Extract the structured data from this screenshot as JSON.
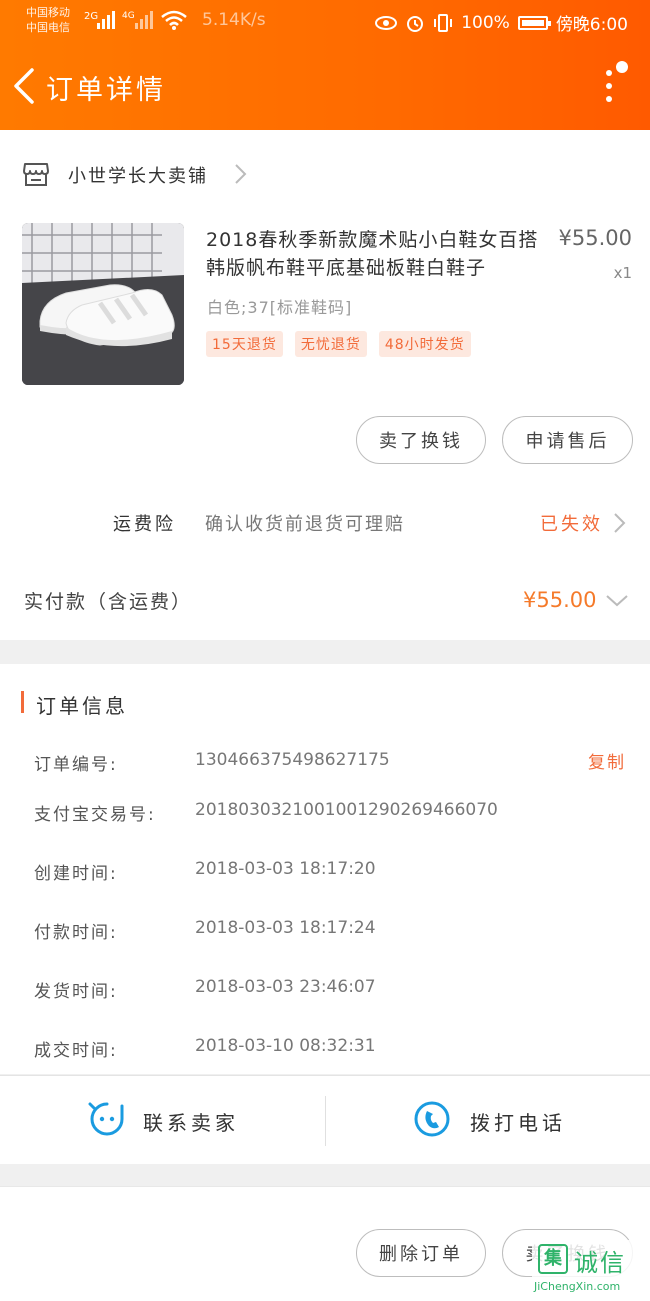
{
  "status_bar": {
    "carrier_1": "中国移动",
    "carrier_2": "中国电信",
    "net_1": "2G",
    "net_2": "4G",
    "speed": "5.14K/s",
    "battery": "100%",
    "time": "傍晚6:00"
  },
  "nav": {
    "title": "订单详情"
  },
  "shop": {
    "name": "小世学长大卖铺"
  },
  "product": {
    "title": "2018春秋季新款魔术贴小白鞋女百搭韩版帆布鞋平底基础板鞋白鞋子",
    "price": "¥55.00",
    "quantity": "x1",
    "spec": "白色;37[标准鞋码]",
    "tags": [
      "15天退货",
      "无忧退货",
      "48小时发货"
    ]
  },
  "item_actions": {
    "sell_label": "卖了换钱",
    "after_sale_label": "申请售后"
  },
  "insurance": {
    "label": "运费险",
    "desc": "确认收货前退货可理赔",
    "status": "已失效"
  },
  "payment": {
    "label": "实付款（含运费）",
    "value": "¥55.00"
  },
  "order_info": {
    "title": "订单信息",
    "copy_label": "复制",
    "rows": [
      {
        "label": "订单编号:",
        "value": "130466375498627175"
      },
      {
        "label": "支付宝交易号:",
        "value": "2018030321001001290269466070"
      },
      {
        "label": "创建时间:",
        "value": "2018-03-03 18:17:20"
      },
      {
        "label": "付款时间:",
        "value": "2018-03-03 18:17:24"
      },
      {
        "label": "发货时间:",
        "value": "2018-03-03 23:46:07"
      },
      {
        "label": "成交时间:",
        "value": "2018-03-10 08:32:31"
      }
    ]
  },
  "contact": {
    "seller_label": "联系卖家",
    "call_label": "拨打电话"
  },
  "bottom": {
    "delete_label": "删除订单",
    "sell_label": "卖了换钱"
  },
  "watermark": {
    "logo_char": "集",
    "text": "诚信",
    "url": "JiChengXin.com"
  },
  "colors": {
    "header_orange": "#ff6a00",
    "accent": "#f26b3a",
    "price_orange": "#f57a2a",
    "icon_blue": "#1a9be0"
  }
}
